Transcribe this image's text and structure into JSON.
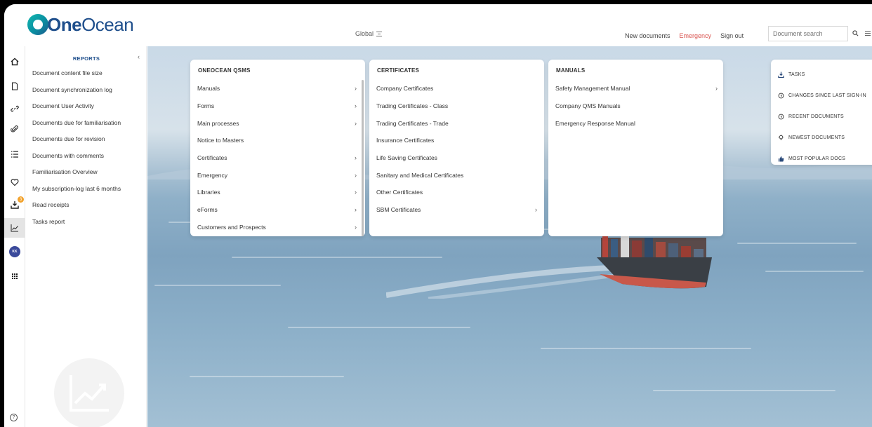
{
  "brand": {
    "prefix": "One",
    "suffix": "Ocean"
  },
  "header": {
    "scope_label": "Global",
    "links": {
      "new_documents": "New documents",
      "emergency": "Emergency",
      "sign_out": "Sign out"
    },
    "search_placeholder": "Document search"
  },
  "rail": {
    "items": [
      "home-icon",
      "document-icon",
      "link-icon",
      "paperclip-icon",
      "list-icon",
      "heart-icon",
      "tasks-icon",
      "chart-icon",
      "avatar",
      "apps-grid-icon"
    ],
    "active": "chart-icon",
    "tasks_badge": "3",
    "avatar_initials": "KK"
  },
  "reports": {
    "title": "REPORTS",
    "collapse": "‹",
    "items": [
      "Document content file size",
      "Document synchronization log",
      "Document User Activity",
      "Documents due for familiarisation",
      "Documents due for revision",
      "Documents with comments",
      "Familiarisation Overview",
      "My subscription-log last 6 months",
      "Read receipts",
      "Tasks report"
    ]
  },
  "menu": {
    "qsms": {
      "title": "ONEOCEAN QSMS",
      "items": [
        {
          "label": "Manuals",
          "arrow": "›"
        },
        {
          "label": "Forms",
          "arrow": "›"
        },
        {
          "label": "Main processes",
          "arrow": "›"
        },
        {
          "label": "Notice to Masters",
          "arrow": ""
        },
        {
          "label": "Certificates",
          "arrow": "›"
        },
        {
          "label": "Emergency",
          "arrow": "›"
        },
        {
          "label": "Libraries",
          "arrow": "›"
        },
        {
          "label": "eForms",
          "arrow": "›"
        },
        {
          "label": "Customers and Prospects",
          "arrow": "›"
        }
      ]
    },
    "certificates": {
      "title": "CERTIFICATES",
      "items": [
        {
          "label": "Company Certificates",
          "arrow": ""
        },
        {
          "label": "Trading Certificates - Class",
          "arrow": ""
        },
        {
          "label": "Trading Certificates - Trade",
          "arrow": ""
        },
        {
          "label": "Insurance Certificates",
          "arrow": ""
        },
        {
          "label": "Life Saving Certificates",
          "arrow": ""
        },
        {
          "label": "Sanitary and Medical Certificates",
          "arrow": ""
        },
        {
          "label": "Other Certificates",
          "arrow": ""
        },
        {
          "label": "SBM Certificates",
          "arrow": "›"
        }
      ]
    },
    "manuals": {
      "title": "MANUALS",
      "items": [
        {
          "label": "Safety Management Manual",
          "arrow": "›"
        },
        {
          "label": "Company QMS Manuals",
          "arrow": ""
        },
        {
          "label": "Emergency Response Manual",
          "arrow": ""
        }
      ]
    }
  },
  "quick": {
    "items": [
      {
        "icon": "download-tray-icon",
        "label": "TASKS"
      },
      {
        "icon": "history-icon",
        "label": "CHANGES SINCE LAST SIGN-IN"
      },
      {
        "icon": "history-icon",
        "label": "RECENT DOCUMENTS"
      },
      {
        "icon": "lightbulb-icon",
        "label": "NEWEST DOCUMENTS"
      },
      {
        "icon": "thumbs-up-icon",
        "label": "MOST POPULAR DOCS"
      }
    ]
  },
  "help": "?"
}
